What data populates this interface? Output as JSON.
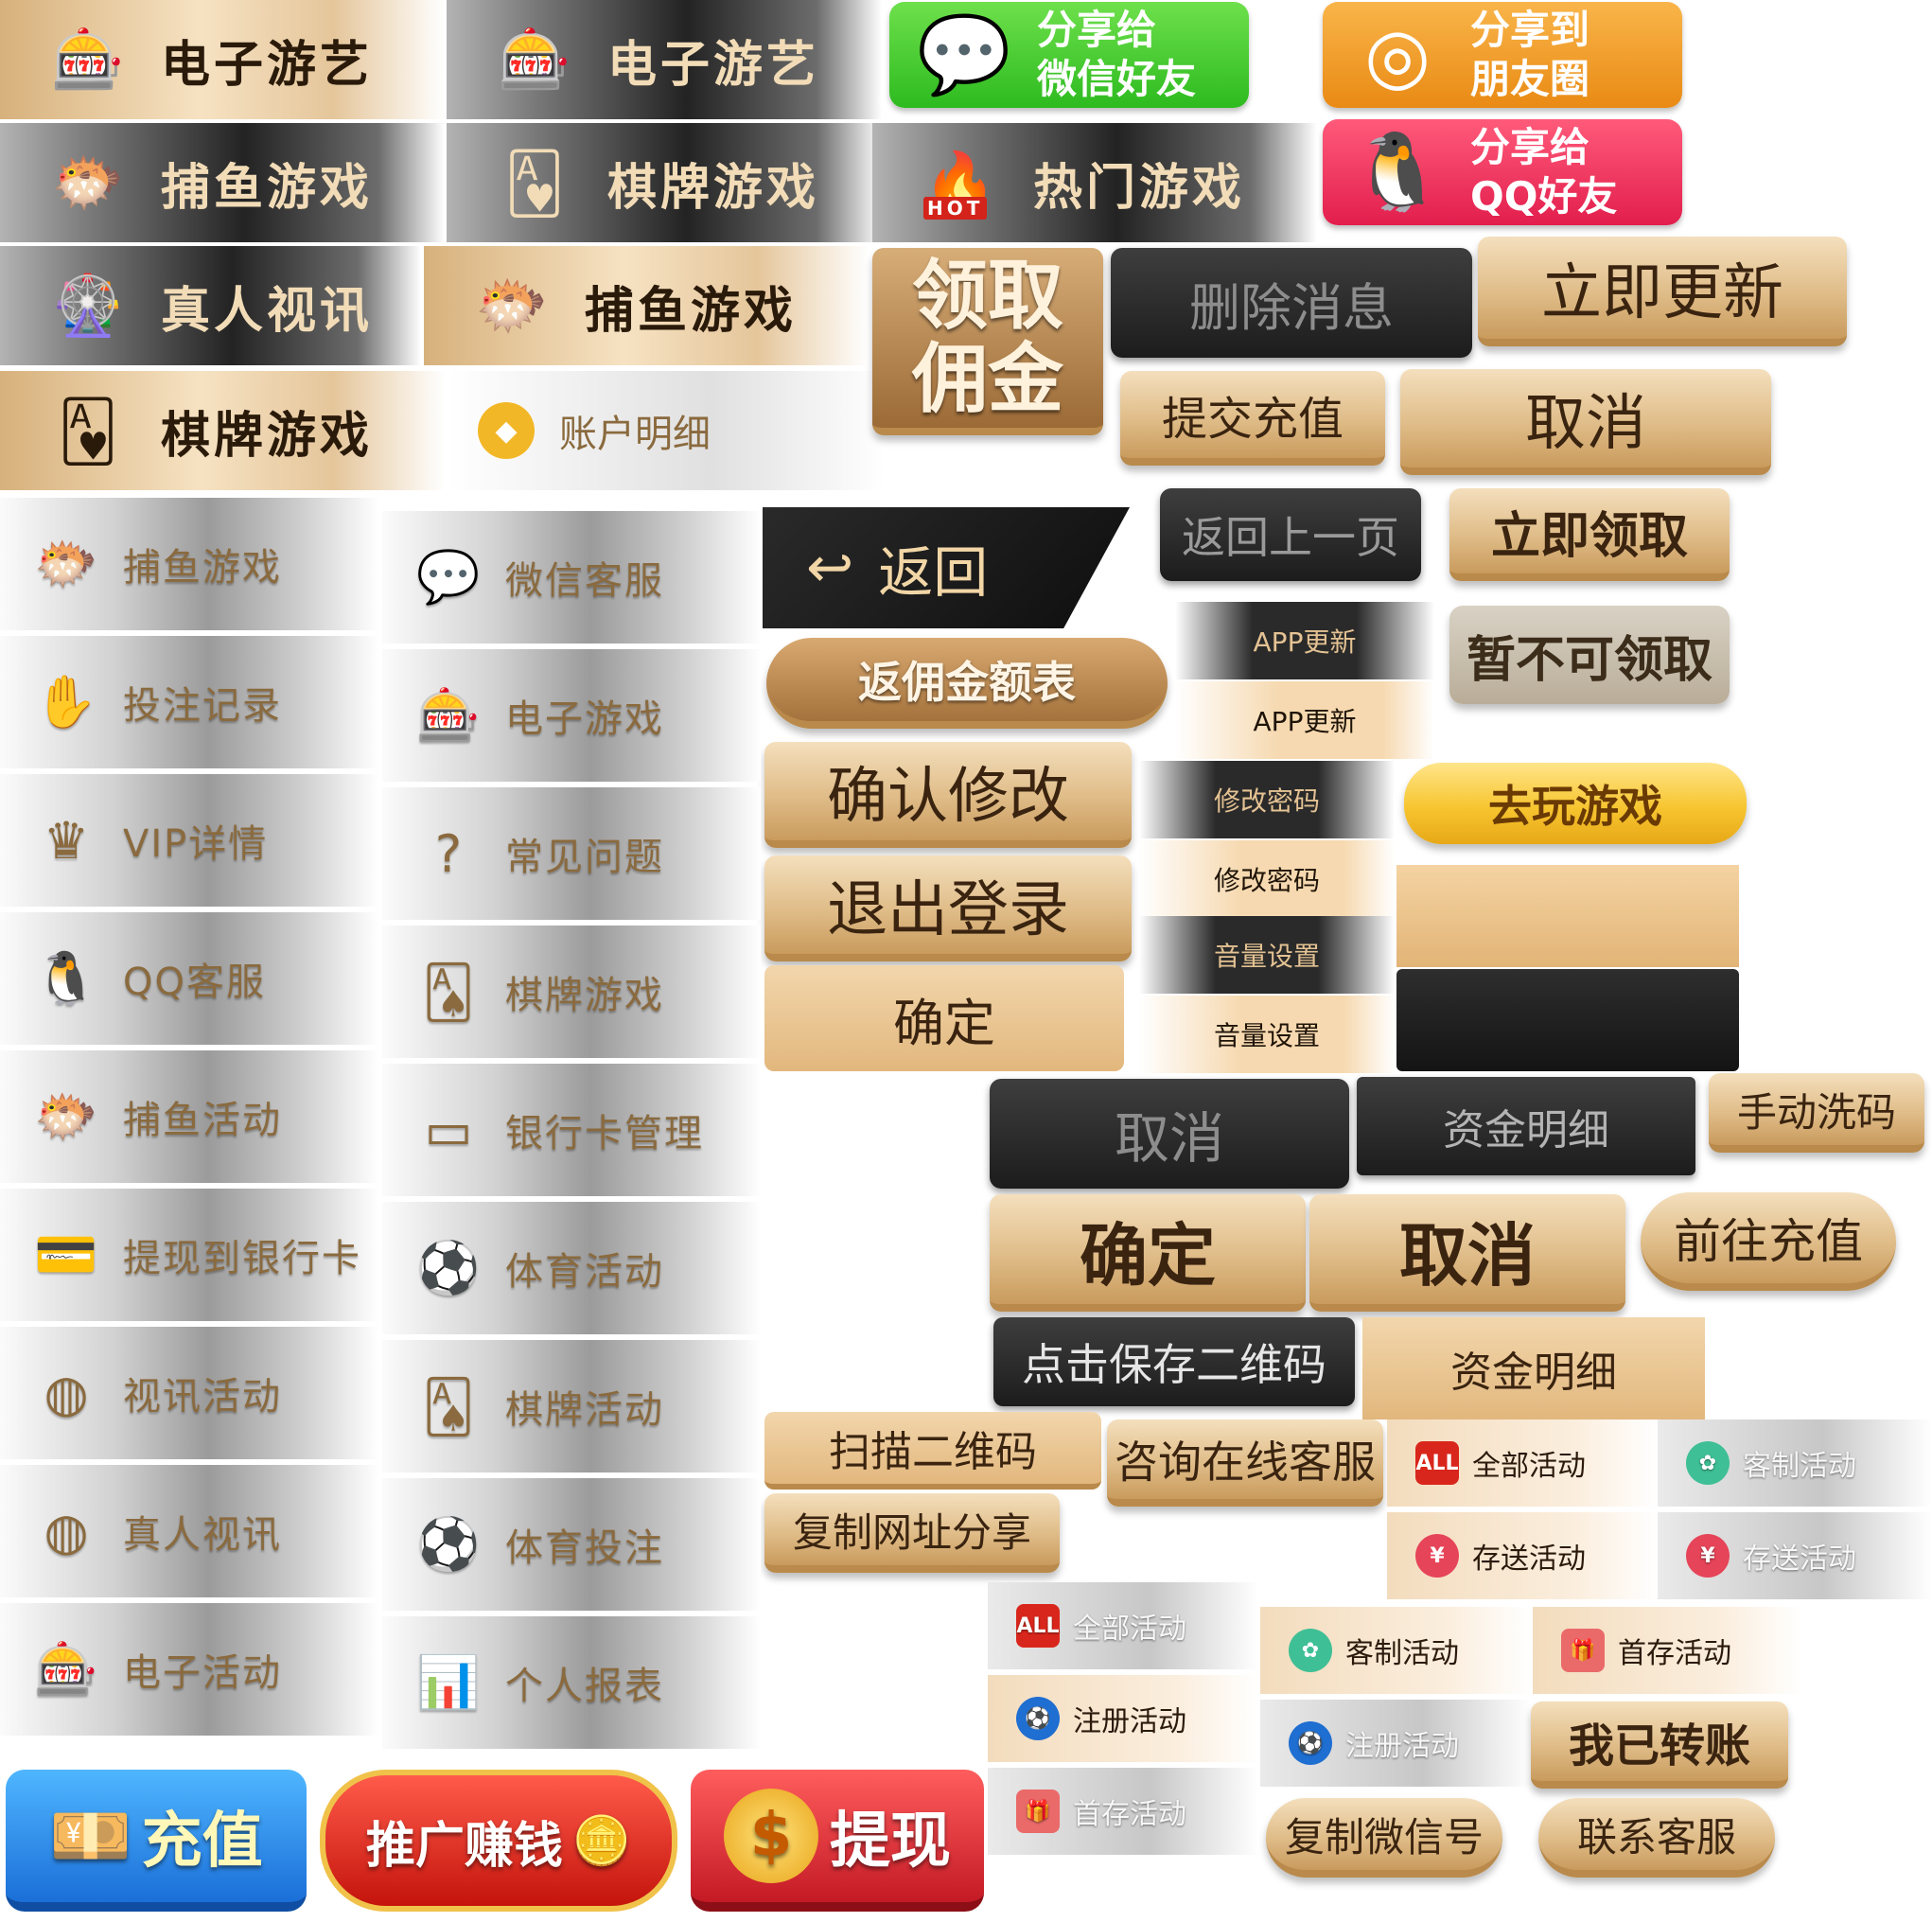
{
  "tabs_big": {
    "electronic_active": "电子游艺",
    "electronic_inactive": "电子游艺",
    "fishing_inactive": "捕鱼游戏",
    "chess_inactive": "棋牌游戏",
    "hot_games": "热门游戏",
    "live_inactive": "真人视讯",
    "fishing_active": "捕鱼游戏",
    "chess_active": "棋牌游戏",
    "account_detail": "账户明细"
  },
  "share": {
    "wechat_line1": "分享给",
    "wechat_line2": "微信好友",
    "moments_line1": "分享到",
    "moments_line2": "朋友圈",
    "qq_line1": "分享给",
    "qq_line2": "QQ好友"
  },
  "buttons": {
    "claim_commission_1": "领取",
    "claim_commission_2": "佣金",
    "delete_message": "删除消息",
    "update_now": "立即更新",
    "submit_recharge": "提交充值",
    "cancel_1": "取消",
    "back": "返回",
    "back_prev_page": "返回上一页",
    "claim_now": "立即领取",
    "commission_table": "返佣金额表",
    "app_update_dark": "APP更新",
    "app_update_gold": "APP更新",
    "not_claimable": "暂不可领取",
    "confirm_modify": "确认修改",
    "change_pwd_dark": "修改密码",
    "change_pwd_gold": "修改密码",
    "go_play": "去玩游戏",
    "logout": "退出登录",
    "volume_dark": "音量设置",
    "volume_gold": "音量设置",
    "ok_1": "确定",
    "cancel_dark": "取消",
    "fund_detail_dark": "资金明细",
    "manual_wash": "手动洗码",
    "ok_2": "确定",
    "cancel_2": "取消",
    "go_recharge": "前往充值",
    "save_qr": "点击保存二维码",
    "fund_detail_gold": "资金明细",
    "scan_qr": "扫描二维码",
    "online_service": "咨询在线客服",
    "copy_url": "复制网址分享",
    "transferred": "我已转账",
    "copy_wechat": "复制微信号",
    "contact_service": "联系客服"
  },
  "menu_left": [
    {
      "label": "捕鱼游戏",
      "icon": "fish-icon"
    },
    {
      "label": "投注记录",
      "icon": "hand-icon"
    },
    {
      "label": "VIP详情",
      "icon": "vip-crown-icon"
    },
    {
      "label": "QQ客服",
      "icon": "qq-penguin-icon"
    },
    {
      "label": "捕鱼活动",
      "icon": "fish-icon"
    },
    {
      "label": "提现到银行卡",
      "icon": "unionpay-icon"
    },
    {
      "label": "视讯活动",
      "icon": "disc-icon"
    },
    {
      "label": "真人视讯",
      "icon": "disc-icon"
    },
    {
      "label": "电子活动",
      "icon": "slot-machine-icon"
    }
  ],
  "menu_right": [
    {
      "label": "微信客服",
      "icon": "wechat-icon"
    },
    {
      "label": "电子游戏",
      "icon": "slot-machine-icon"
    },
    {
      "label": "常见问题",
      "icon": "question-icon"
    },
    {
      "label": "棋牌游戏",
      "icon": "cards-icon"
    },
    {
      "label": "银行卡管理",
      "icon": "bank-card-icon"
    },
    {
      "label": "体育活动",
      "icon": "soccer-icon"
    },
    {
      "label": "棋牌活动",
      "icon": "cards-icon"
    },
    {
      "label": "体育投注",
      "icon": "soccer-icon"
    },
    {
      "label": "个人报表",
      "icon": "chart-icon"
    }
  ],
  "activities": {
    "all_gold": "全部活动",
    "custom_grey": "客制活动",
    "deposit_gift_gold": "存送活动",
    "deposit_gift_grey": "存送活动",
    "all_grey": "全部活动",
    "custom_gold": "客制活动",
    "first_deposit_gold": "首存活动",
    "register_gold": "注册活动",
    "register_grey": "注册活动",
    "first_deposit_grey": "首存活动",
    "all_badge": "ALL"
  },
  "promo": {
    "recharge": "充值",
    "promote": "推广赚钱",
    "withdraw": "提现"
  },
  "icons": {
    "hot_badge": "HOT"
  }
}
